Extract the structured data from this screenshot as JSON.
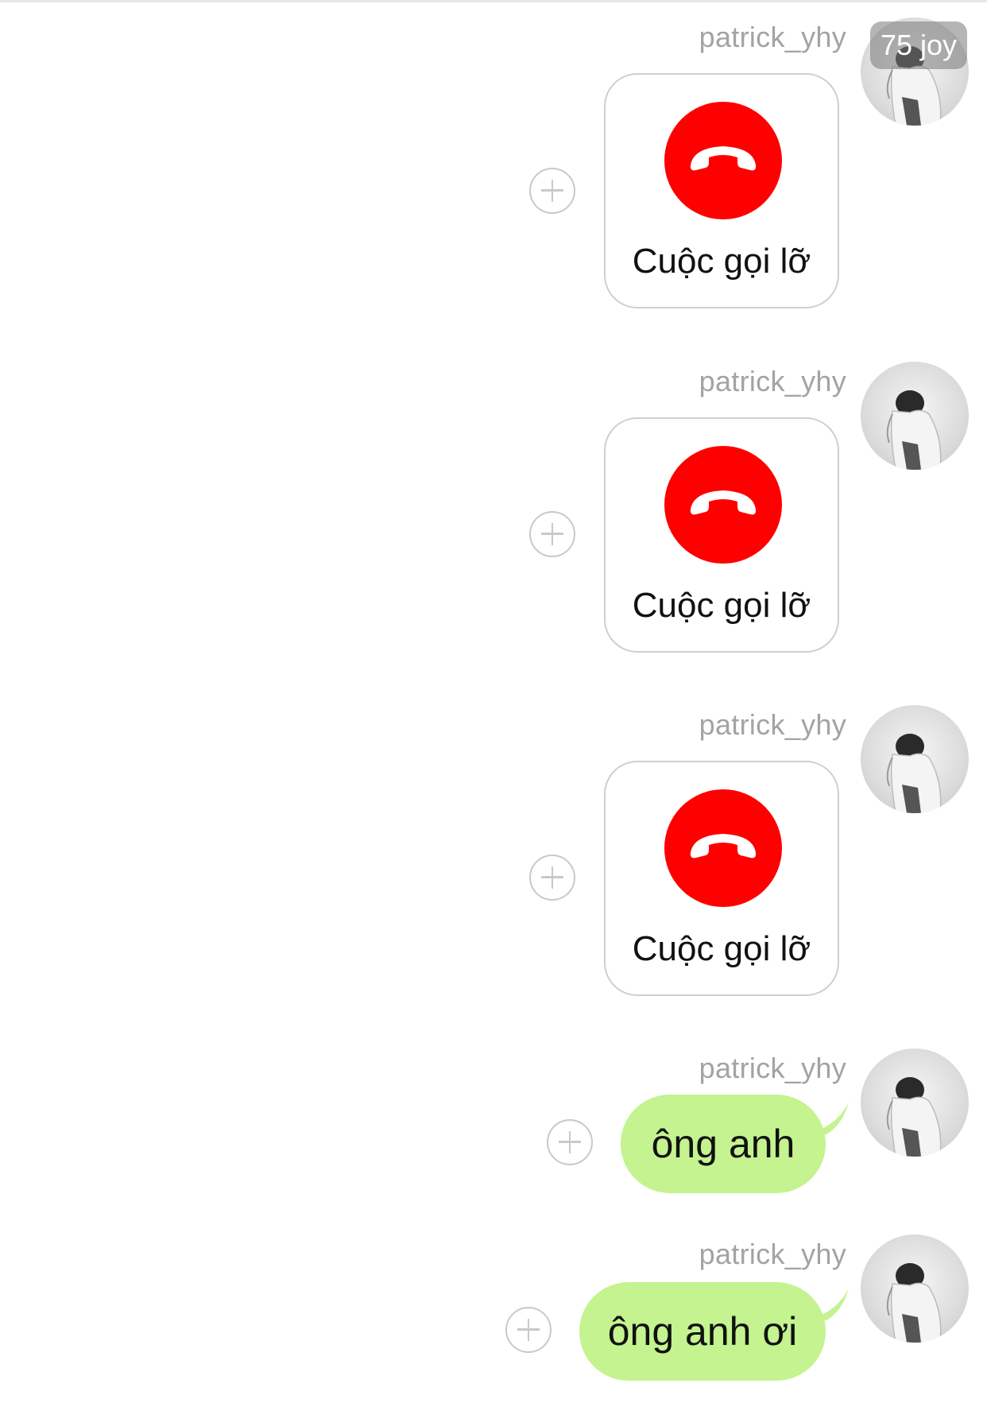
{
  "badge": {
    "text": "75 joy"
  },
  "messages": [
    {
      "sender": "patrick_yhy",
      "type": "call",
      "label": "Cuộc gọi lỡ"
    },
    {
      "sender": "patrick_yhy",
      "type": "call",
      "label": "Cuộc gọi lỡ"
    },
    {
      "sender": "patrick_yhy",
      "type": "call",
      "label": "Cuộc gọi lỡ"
    },
    {
      "sender": "patrick_yhy",
      "type": "text",
      "text": "ông anh"
    },
    {
      "sender": "patrick_yhy",
      "type": "text",
      "text": "ông anh ơi"
    }
  ],
  "colors": {
    "missed_call": "#ff0000",
    "bubble": "#c4f38f",
    "sender_text": "#a3a3a3"
  },
  "icons": {
    "call": "phone-hangup-icon",
    "add": "plus-circle-icon"
  }
}
